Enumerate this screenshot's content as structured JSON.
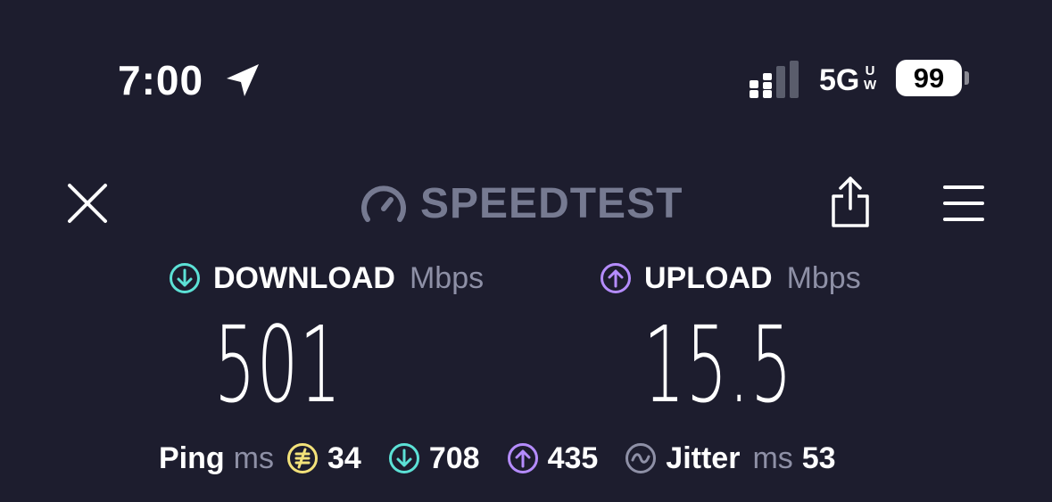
{
  "status_bar": {
    "time": "7:00",
    "network": "5G",
    "network_suffix_top": "U",
    "network_suffix_bottom": "W",
    "battery": "99"
  },
  "header": {
    "logo_text": "SPEEDTEST"
  },
  "download": {
    "label": "DOWNLOAD",
    "unit": "Mbps",
    "value": "501"
  },
  "upload": {
    "label": "UPLOAD",
    "unit": "Mbps",
    "value": "15.5"
  },
  "stats": {
    "ping_label": "Ping",
    "ping_unit": "ms",
    "idle_ping": "34",
    "download_ping": "708",
    "upload_ping": "435",
    "jitter_label": "Jitter",
    "jitter_unit": "ms",
    "jitter": "53"
  },
  "colors": {
    "background": "#1d1d2e",
    "download_accent": "#5ce1d6",
    "upload_accent": "#b58cff",
    "ping_accent": "#f3e27a",
    "muted_text": "#8e90a6"
  }
}
